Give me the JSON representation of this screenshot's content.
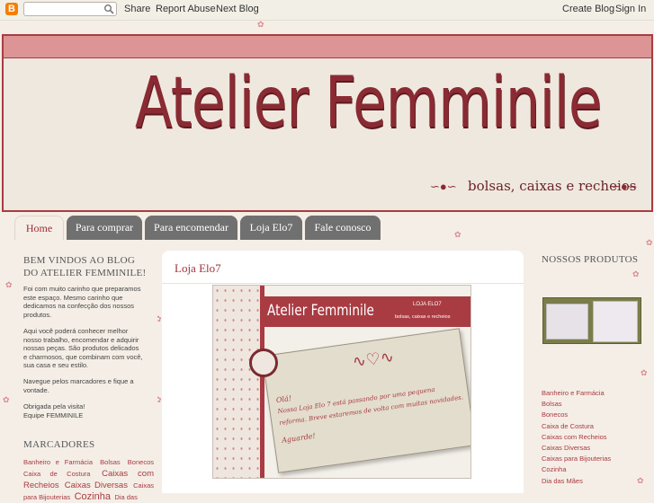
{
  "navbar": {
    "share": "Share",
    "report_abuse": "Report Abuse",
    "next_blog": "Next Blog",
    "create_blog": "Create Blog",
    "sign_in": "Sign In",
    "logo_letter": "B"
  },
  "header": {
    "title": "Atelier Femminile",
    "subtitle": "bolsas, caixas e recheios",
    "swirl": "∽●∽"
  },
  "tabs": [
    {
      "label": "Home"
    },
    {
      "label": "Para comprar"
    },
    {
      "label": "Para encomendar"
    },
    {
      "label": "Loja Elo7"
    },
    {
      "label": "Fale conosco"
    }
  ],
  "sidebar_left": {
    "welcome_title": "BEM VINDOS AO BLOG DO ATELIER FEMMINILE!",
    "welcome_lines": [
      "Foi com muito carinho que preparamos",
      "este espaço. Mesmo carinho que",
      "dedicamos na confecção dos nossos",
      "produtos."
    ],
    "para2_lines": [
      "Aqui você poderá conhecer melhor",
      "nosso trabalho, encomendar e adquirir",
      "nossas peças. São produtos delicados",
      "e charmosos, que combinam com você,",
      "sua casa e seu estilo."
    ],
    "para3_lines": [
      "Navegue pelos marcadores e fique a",
      "vontade."
    ],
    "thanks_lines": [
      "Obrigada pela visita!",
      "Equipe FEMMINILE"
    ],
    "labels_title": "MARCADORES",
    "labels": [
      "Banheiro e Farmácia",
      "Bolsas",
      "Bonecos",
      "Caixa de Costura",
      "Caixas com Recheios",
      "Caixas Diversas",
      "Caixas para Bijouterias",
      "Cozinha",
      "Dia das"
    ]
  },
  "post": {
    "title": "Loja Elo7",
    "image": {
      "brand": "Atelier Femminile",
      "label": "LOJA ELO7",
      "small_sub": "bolsas, caixas e recheios",
      "note_lines": [
        "Olá!",
        "Nossa Loja Elo 7 está passando por uma pequena",
        "reforma. Breve estaremos de volta com muitas novidades.",
        "Aguarde!"
      ]
    }
  },
  "sidebar_right": {
    "products_title": "NOSSOS PRODUTOS",
    "links": [
      "Banheiro e Farmácia",
      "Bolsas",
      "Bonecos",
      "Caixa de Costura",
      "Caixas com Recheios",
      "Caixas Diversas",
      "Caixas para Bijouterias",
      "Cozinha",
      "Dia das Mães"
    ]
  },
  "colors": {
    "accent": "#a93b42",
    "header_band": "#dd9495",
    "tab_gray": "#707070",
    "background": "#f4eee6"
  }
}
